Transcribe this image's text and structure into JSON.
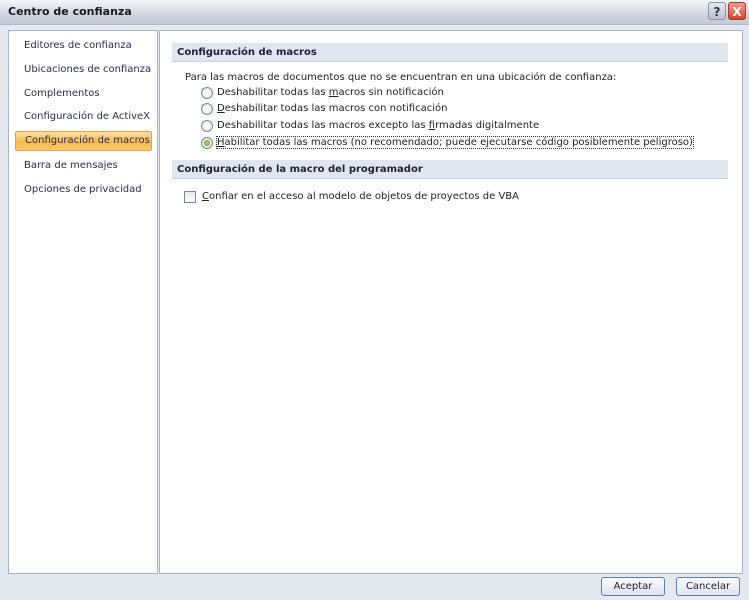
{
  "window": {
    "title": "Centro de confianza",
    "help": "?",
    "close": "X"
  },
  "sidebar": {
    "items": [
      {
        "label": "Editores de confianza"
      },
      {
        "label": "Ubicaciones de confianza"
      },
      {
        "label": "Complementos"
      },
      {
        "label": "Configuración de ActiveX"
      },
      {
        "label": "Configuración de macros",
        "selected": true
      },
      {
        "label": "Barra de mensajes"
      },
      {
        "label": "Opciones de privacidad"
      }
    ]
  },
  "macros": {
    "header": "Configuración de macros",
    "intro": "Para las macros de documentos que no se encuentran en una ubicación de confianza:",
    "options": [
      {
        "pre": "Deshabilitar todas las ",
        "key": "m",
        "post": "acros sin notificación",
        "checked": false
      },
      {
        "pre": "",
        "key": "D",
        "post": "eshabilitar todas las macros con notificación",
        "checked": false
      },
      {
        "pre": "Deshabilitar todas las macros excepto las ",
        "key": "f",
        "post": "irmadas digitalmente",
        "checked": false
      },
      {
        "pre": "",
        "key": "H",
        "post": "abilitar todas las macros (no recomendado; puede ejecutarse código posiblemente peligroso)",
        "checked": true
      }
    ]
  },
  "developer": {
    "header": "Configuración de la macro del programador",
    "vba": {
      "pre": "",
      "key": "C",
      "post": "onfiar en el acceso al modelo de objetos de proyectos de VBA",
      "checked": false
    }
  },
  "buttons": {
    "ok": "Aceptar",
    "cancel": "Cancelar"
  }
}
